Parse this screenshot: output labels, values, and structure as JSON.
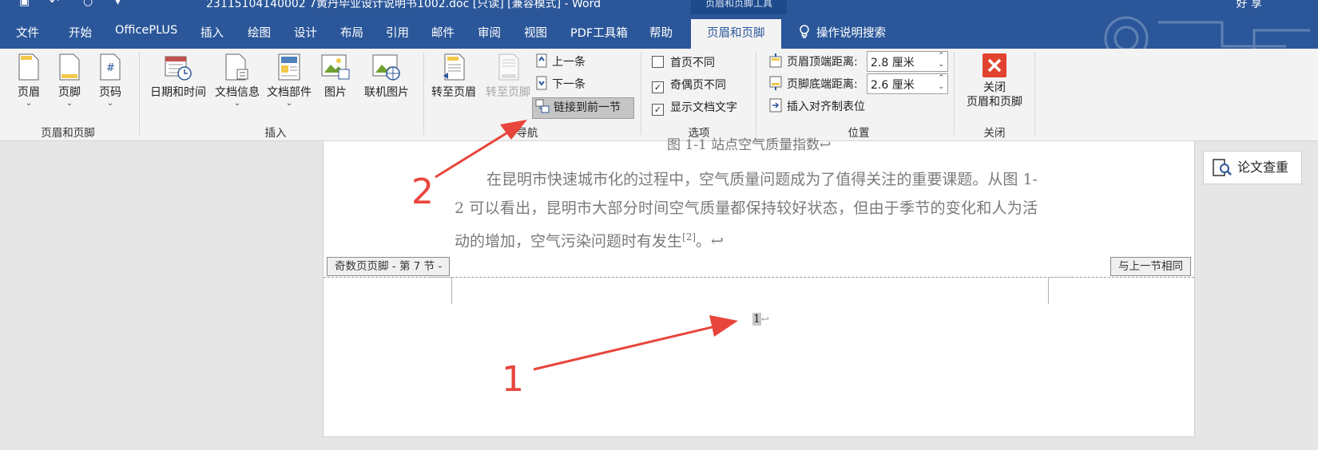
{
  "titlebar": {
    "title": "23115104140002 7黄丹毕业设计说明书1002.doc [只读] [兼容模式] - Word",
    "user": "好 享",
    "tool_tab_header": "页眉和页脚工具"
  },
  "tabs": [
    "文件",
    "开始",
    "OfficePLUS",
    "插入",
    "绘图",
    "设计",
    "布局",
    "引用",
    "邮件",
    "审阅",
    "视图",
    "PDF工具箱",
    "帮助",
    "页眉和页脚"
  ],
  "tell_me": "操作说明搜索",
  "ribbon": {
    "hf_group": {
      "header": "页眉",
      "footer": "页脚",
      "page_number": "页码",
      "label": "页眉和页脚"
    },
    "insert_group": {
      "date_time": "日期和时间",
      "doc_info": "文档信息",
      "doc_parts": "文档部件",
      "picture": "图片",
      "online_picture": "联机图片",
      "label": "插入"
    },
    "nav_group": {
      "goto_header": "转至页眉",
      "goto_footer": "转至页脚",
      "previous": "上一条",
      "next": "下一条",
      "link_previous": "链接到前一节",
      "label": "导航"
    },
    "options_group": {
      "diff_first": "首页不同",
      "diff_odd_even": "奇偶页不同",
      "show_doc_text": "显示文档文字",
      "label": "选项",
      "diff_first_checked": false,
      "diff_odd_even_checked": true,
      "show_doc_text_checked": true
    },
    "position_group": {
      "header_from_top": "页眉顶端距离:",
      "header_value": "2.8 厘米",
      "footer_from_bottom": "页脚底端距离:",
      "footer_value": "2.6 厘米",
      "insert_align_tab": "插入对齐制表位",
      "label": "位置"
    },
    "close_group": {
      "close_line1": "关闭",
      "close_line2": "页眉和页脚",
      "label": "关闭"
    }
  },
  "document": {
    "figure_caption": "图 1-1 站点空气质量指数↩",
    "paragraph_lines": [
      "在昆明市快速城市化的过程中，空气质量问题成为了值得关注的重要课题。",
      "从图 1-2 可以看出，昆明市大部分时间空气质量都保持较好状态，但由于季节",
      "的变化和人为活动的增加，空气污染问题时有发生"
    ],
    "citation": "[2]",
    "paragraph_end": "。↩",
    "footer_tag": "奇数页页脚 - 第 7 节 -",
    "same_as_prev_tag": "与上一节相同",
    "page_number": "1",
    "return_mark": "↩"
  },
  "side_button": "论文查重",
  "annotations": [
    "1",
    "2"
  ],
  "colors": {
    "accent": "#2b579a",
    "annotation": "#e8453c"
  }
}
